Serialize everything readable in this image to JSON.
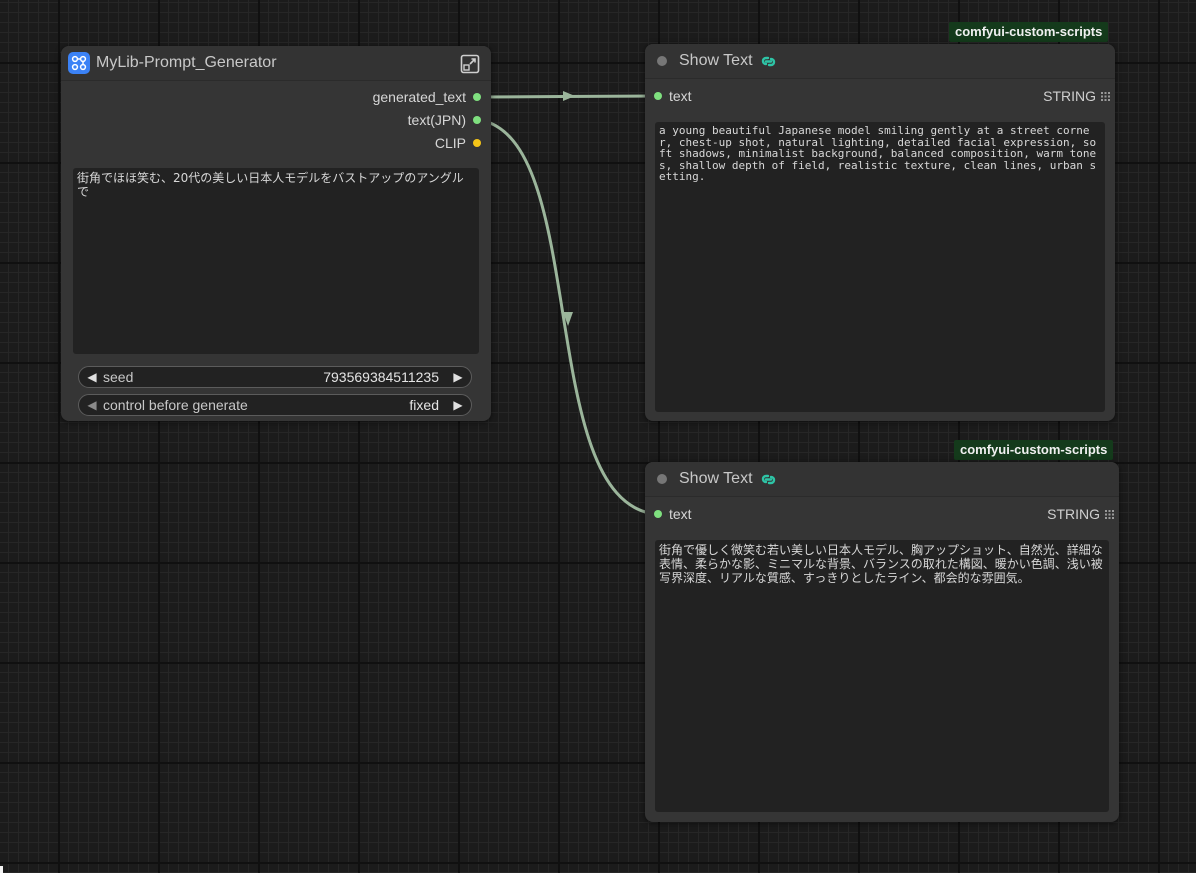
{
  "prompt_node": {
    "title": "MyLib-Prompt_Generator",
    "outputs": [
      {
        "label": "generated_text",
        "color": "#7fe07f"
      },
      {
        "label": "text(JPN)",
        "color": "#7fe07f"
      },
      {
        "label": "CLIP",
        "color": "#f5c518"
      }
    ],
    "prompt_text": "街角でほほ笑む、20代の美しい日本人モデルをバストアップのアングルで",
    "seed": {
      "label": "seed",
      "value": "793569384511235"
    },
    "control": {
      "label": "control before generate",
      "value": "fixed"
    }
  },
  "show_text_1": {
    "tag": "comfyui-custom-scripts",
    "title": "Show Text",
    "input_label": "text",
    "type_label": "STRING",
    "content": "a young beautiful Japanese model smiling gently at a street corner, chest-up shot, natural lighting, detailed facial expression, soft shadows, minimalist background, balanced composition, warm tones, shallow depth of field, realistic texture, clean lines, urban setting."
  },
  "show_text_2": {
    "tag": "comfyui-custom-scripts",
    "title": "Show Text",
    "input_label": "text",
    "type_label": "STRING",
    "content": "街角で優しく微笑む若い美しい日本人モデル、胸アップショット、自然光、詳細な表情、柔らかな影、ミニマルな背景、バランスの取れた構図、暖かい色調、浅い被写界深度、リアルな質感、すっきりとしたライン、都会的な雰囲気。"
  },
  "colors": {
    "string_link": "#9bb59b",
    "string_slot": "#7fe07f",
    "clip_slot": "#f5c518",
    "node_bg": "#353535",
    "tag_bg": "#143a1b",
    "accent_blue": "#3b82f6",
    "accent_teal": "#2ec4a6"
  },
  "icons": {
    "prompt_node": "node-workflow-icon",
    "expand": "expand-icon",
    "show_text": "link-icon",
    "type": "grid-icon"
  }
}
